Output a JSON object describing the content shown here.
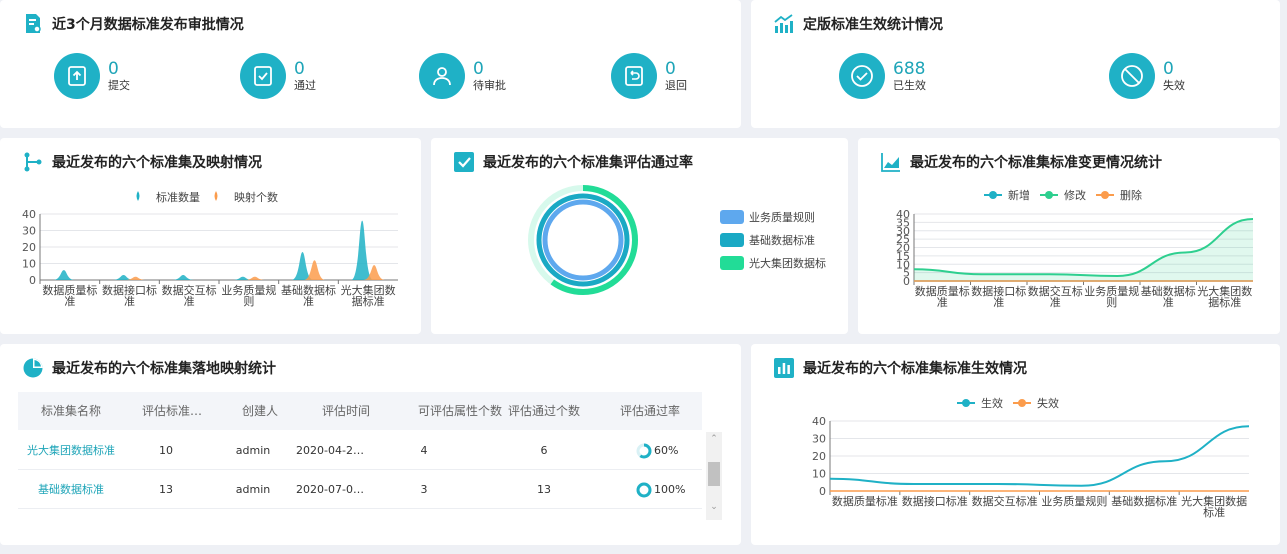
{
  "cards": {
    "approval": {
      "title": "近3个月数据标准发布审批情况",
      "stats": [
        {
          "value": "0",
          "label": "提交",
          "icon": "upload-icon"
        },
        {
          "value": "0",
          "label": "通过",
          "icon": "check-doc-icon"
        },
        {
          "value": "0",
          "label": "待审批",
          "icon": "user-icon"
        },
        {
          "value": "0",
          "label": "退回",
          "icon": "return-icon"
        }
      ]
    },
    "effective": {
      "title": "定版标准生效统计情况",
      "stats": [
        {
          "value": "688",
          "label": "已生效",
          "icon": "check-circle-icon"
        },
        {
          "value": "0",
          "label": "失效",
          "icon": "ban-icon"
        }
      ]
    },
    "mapping": {
      "title": "最近发布的六个标准集及映射情况"
    },
    "passrate": {
      "title": "最近发布的六个标准集评估通过率"
    },
    "change": {
      "title": "最近发布的六个标准集标准变更情况统计"
    },
    "landing": {
      "title": "最近发布的六个标准集落地映射统计"
    },
    "status": {
      "title": "最近发布的六个标准集标准生效情况"
    }
  },
  "table": {
    "headers": [
      "标准集名称",
      "评估标准…",
      "创建人",
      "评估时间",
      "可评估属性个数",
      "评估通过个数",
      "评估通过率"
    ],
    "rows": [
      {
        "name": "光大集团数据标准",
        "count": "10",
        "creator": "admin",
        "time": "2020-04-2…",
        "attrs": "4",
        "passed": "6",
        "rate": "60%",
        "rate_value": 60
      },
      {
        "name": "基础数据标准",
        "count": "13",
        "creator": "admin",
        "time": "2020-07-0…",
        "attrs": "3",
        "passed": "13",
        "rate": "100%",
        "rate_value": 100
      }
    ]
  },
  "colors": {
    "accent": "#1fb1c6",
    "orange": "#fb9c4c",
    "green": "#2ecf8f",
    "blue": "#5ea8ee",
    "teal": "#1aa9c4",
    "mint": "#22dc97"
  },
  "chart_data": [
    {
      "type": "bar",
      "categories": [
        "数据质量标准",
        "数据接口标准",
        "数据交互标准",
        "业务质量规则",
        "基础数据标准",
        "光大集团数据标准"
      ],
      "category_labels": [
        [
          "数据质量标",
          "准"
        ],
        [
          "数据接口标",
          "准"
        ],
        [
          "数据交互标",
          "准"
        ],
        [
          "业务质量规",
          "则"
        ],
        [
          "基础数据标",
          "准"
        ],
        [
          "光大集团数",
          "据标准"
        ]
      ],
      "series": [
        {
          "name": "标准数量",
          "values": [
            6,
            3,
            3,
            2,
            17,
            36
          ]
        },
        {
          "name": "映射个数",
          "values": [
            0,
            2,
            0,
            2,
            12,
            9
          ]
        }
      ],
      "ylim": [
        0,
        40
      ],
      "yticks": [
        0,
        10,
        20,
        30,
        40
      ],
      "legend": "top-center"
    },
    {
      "type": "pie",
      "series": [
        {
          "name": "业务质量规则",
          "value": 100
        },
        {
          "name": "基础数据标准",
          "value": 100
        },
        {
          "name": "光大集团数据标",
          "value": 60
        }
      ],
      "legend": "right"
    },
    {
      "type": "area",
      "categories": [
        "数据质量标准",
        "数据接口标准",
        "数据交互标准",
        "业务质量规则",
        "基础数据标准",
        "光大集团数据标准"
      ],
      "category_labels": [
        [
          "数据质量标",
          "准"
        ],
        [
          "数据接口标",
          "准"
        ],
        [
          "数据交互标",
          "准"
        ],
        [
          "业务质量规",
          "则"
        ],
        [
          "基础数据标",
          "准"
        ],
        [
          "光大集团数",
          "据标准"
        ]
      ],
      "series": [
        {
          "name": "新增",
          "values": [
            0,
            0,
            0,
            0,
            0,
            0
          ]
        },
        {
          "name": "修改",
          "values": [
            7,
            4,
            4,
            3,
            17,
            37
          ]
        },
        {
          "name": "删除",
          "values": [
            0,
            0,
            0,
            0,
            0,
            0
          ]
        }
      ],
      "ylim": [
        0,
        40
      ],
      "yticks": [
        0,
        5,
        10,
        15,
        20,
        25,
        30,
        35,
        40
      ],
      "legend": "top-center"
    },
    {
      "type": "line",
      "categories": [
        "数据质量标准",
        "数据接口标准",
        "数据交互标准",
        "业务质量规则",
        "基础数据标准",
        "光大集团数据标准"
      ],
      "category_labels": [
        [
          "数据质量标准"
        ],
        [
          "数据接口标准"
        ],
        [
          "数据交互标准"
        ],
        [
          "业务质量规则"
        ],
        [
          "基础数据标准"
        ],
        [
          "光大集团数据",
          "标准"
        ]
      ],
      "series": [
        {
          "name": "生效",
          "values": [
            7,
            4,
            4,
            3,
            17,
            37
          ]
        },
        {
          "name": "失效",
          "values": [
            0,
            0,
            0,
            0,
            0,
            0
          ]
        }
      ],
      "ylim": [
        0,
        40
      ],
      "yticks": [
        0,
        10,
        20,
        30,
        40
      ],
      "legend": "top-center"
    }
  ]
}
